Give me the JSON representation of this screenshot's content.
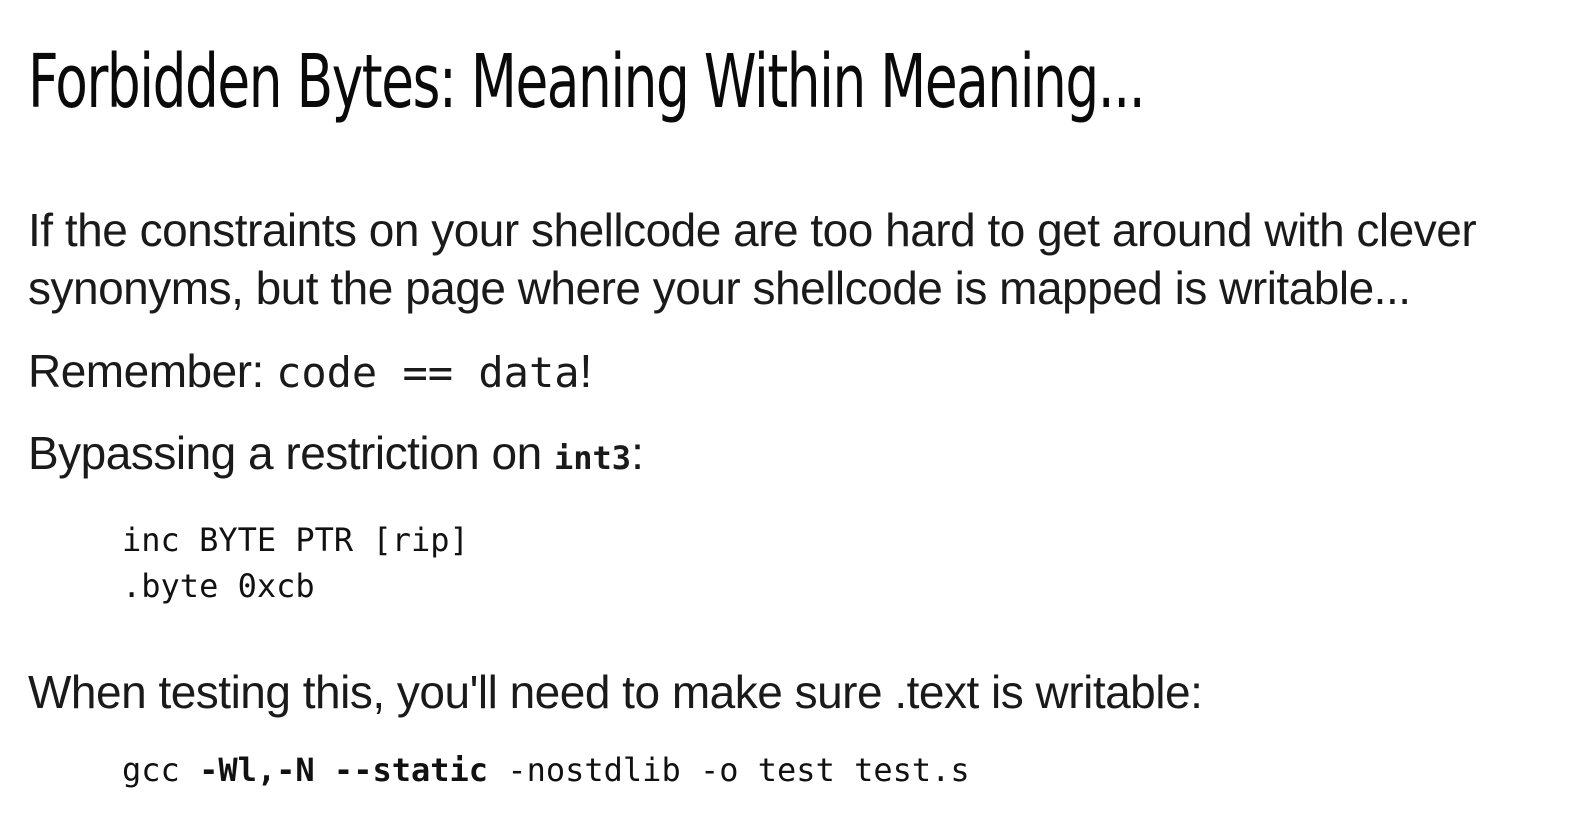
{
  "title": "Forbidden Bytes: Meaning Within Meaning...",
  "paragraph1": {
    "line1": "If the constraints on your shellcode are too hard to get around with clever",
    "line2": "synonyms, but the page where your shellcode is mapped is writable..."
  },
  "paragraph2": {
    "prefix": "Remember: ",
    "code": "code == data",
    "suffix": "!"
  },
  "paragraph3": {
    "prefix": "Bypassing a restriction on ",
    "code": "int3",
    "suffix": ":"
  },
  "code_block1": {
    "line1": "inc BYTE PTR [rip]",
    "line2": ".byte 0xcb"
  },
  "paragraph4": "When testing this, you'll need to make sure .text is writable:",
  "code_block2": {
    "part1": "gcc ",
    "part2_bold": "-Wl,-N --static",
    "part3": " -nostdlib -o test test.s"
  }
}
